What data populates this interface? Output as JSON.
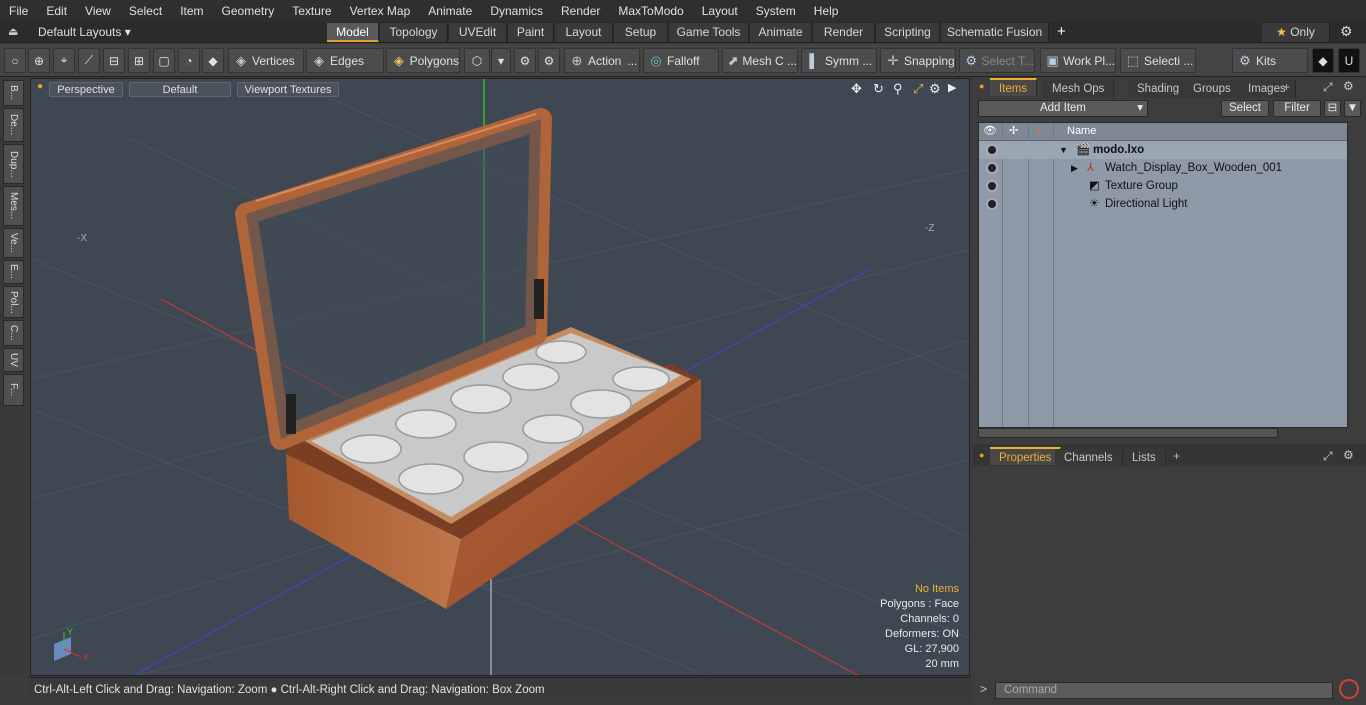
{
  "menu": [
    "File",
    "Edit",
    "View",
    "Select",
    "Item",
    "Geometry",
    "Texture",
    "Vertex Map",
    "Animate",
    "Dynamics",
    "Render",
    "MaxToModo",
    "Layout",
    "System",
    "Help"
  ],
  "layouts": {
    "label": "Default Layouts ▾",
    "only": "Only"
  },
  "tabs": [
    "Model",
    "Topology",
    "UVEdit",
    "Paint",
    "Layout",
    "Setup",
    "Game Tools",
    "Animate",
    "Render",
    "Scripting",
    "Schematic Fusion"
  ],
  "toolbar": {
    "vertices": "Vertices",
    "edges": "Edges",
    "polygons": "Polygons",
    "action": "Action",
    "falloff": "Falloff",
    "mesh": "Mesh C ...",
    "symm": "Symm ...",
    "snapping": "Snapping",
    "select_t": "Select T...",
    "work_pl": "Work Pl...",
    "selecti": "Selecti ...",
    "kits": "Kits"
  },
  "left_tabs": [
    "B...",
    "De...",
    "Dup...",
    "Mes...",
    "Ve...",
    "E...",
    "Pol...",
    "C...",
    "UV",
    "F..."
  ],
  "viewport": {
    "perspective": "Perspective",
    "style": "Default",
    "textures": "Viewport Textures",
    "axis_x": "-X",
    "axis_z": "-Z",
    "gizmo_y": "Y",
    "gizmo_x": "X"
  },
  "vpinfo": {
    "items": "No Items",
    "polygons": "Polygons : Face",
    "channels": "Channels: 0",
    "deformers": "Deformers: ON",
    "gl": "GL: 27,900",
    "size": "20 mm"
  },
  "status": "Ctrl-Alt-Left Click and Drag: Navigation: Zoom ● Ctrl-Alt-Right Click and Drag: Navigation: Box Zoom",
  "right": {
    "tabs": [
      "Items",
      "Mesh Ops",
      "Shading",
      "Groups",
      "Images"
    ],
    "add_item": "Add Item",
    "select": "Select",
    "filter": "Filter",
    "col_name": "Name",
    "items": [
      {
        "name": "modo.lxo",
        "indent": 0
      },
      {
        "name": "Watch_Display_Box_Wooden_001",
        "indent": 1
      },
      {
        "name": "Texture Group",
        "indent": 1
      },
      {
        "name": "Directional Light",
        "indent": 1
      }
    ],
    "prop_tabs": [
      "Properties",
      "Channels",
      "Lists"
    ],
    "command": "Command"
  }
}
